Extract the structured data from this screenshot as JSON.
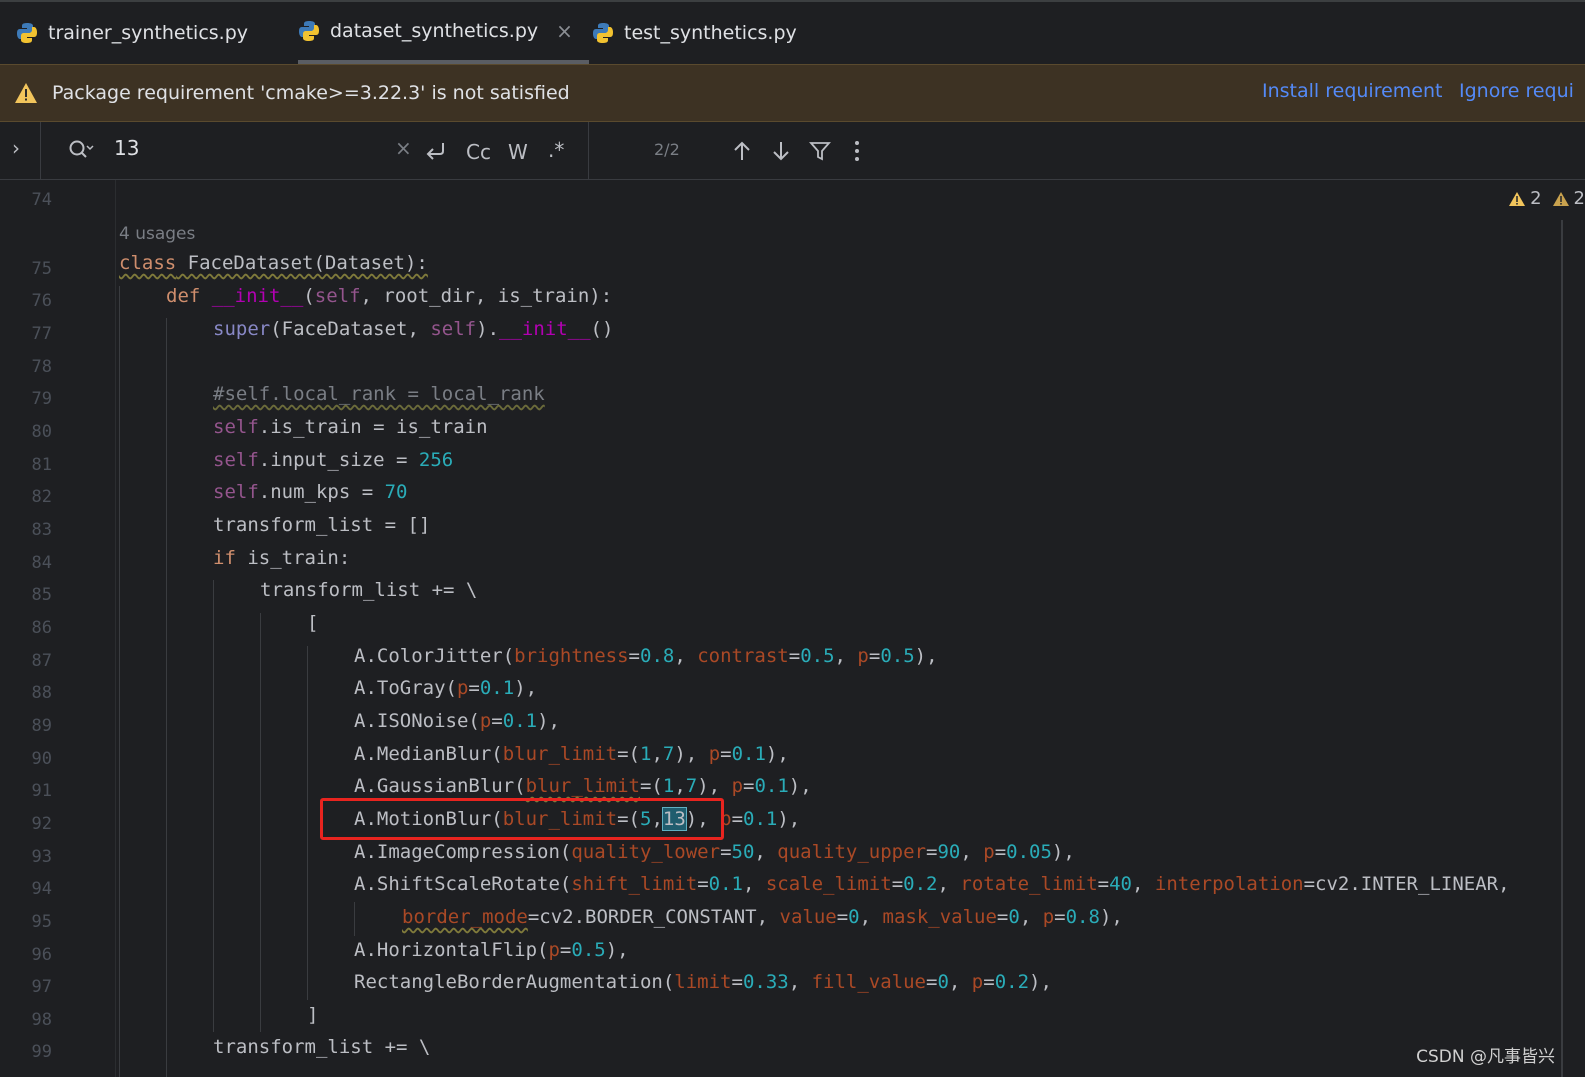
{
  "tabs": [
    {
      "label": "trainer_synthetics.py",
      "active": false
    },
    {
      "label": "dataset_synthetics.py",
      "active": true
    },
    {
      "label": "test_synthetics.py",
      "active": false
    }
  ],
  "banner": {
    "message": "Package requirement 'cmake>=3.22.3' is not satisfied",
    "install_label": "Install requirement",
    "ignore_label": "Ignore requi"
  },
  "search": {
    "query": "13",
    "clear_glyph": "×",
    "case_label": "Cc",
    "word_label": "W",
    "regex_label": ".*",
    "match_count": "2/2"
  },
  "inspections": {
    "warnings": "2",
    "weak_warnings": "2"
  },
  "usages_hint": "4 usages",
  "line_numbers": [
    "74",
    "75",
    "76",
    "77",
    "78",
    "79",
    "80",
    "81",
    "82",
    "83",
    "84",
    "85",
    "86",
    "87",
    "88",
    "89",
    "90",
    "91",
    "92",
    "93",
    "94",
    "95",
    "96",
    "97",
    "98",
    "99"
  ],
  "watermark": "CSDN @凡事皆兴",
  "colors": {
    "accent": "#548af7",
    "highlight_box": "#e8241f",
    "banner_bg": "#3d3223"
  }
}
